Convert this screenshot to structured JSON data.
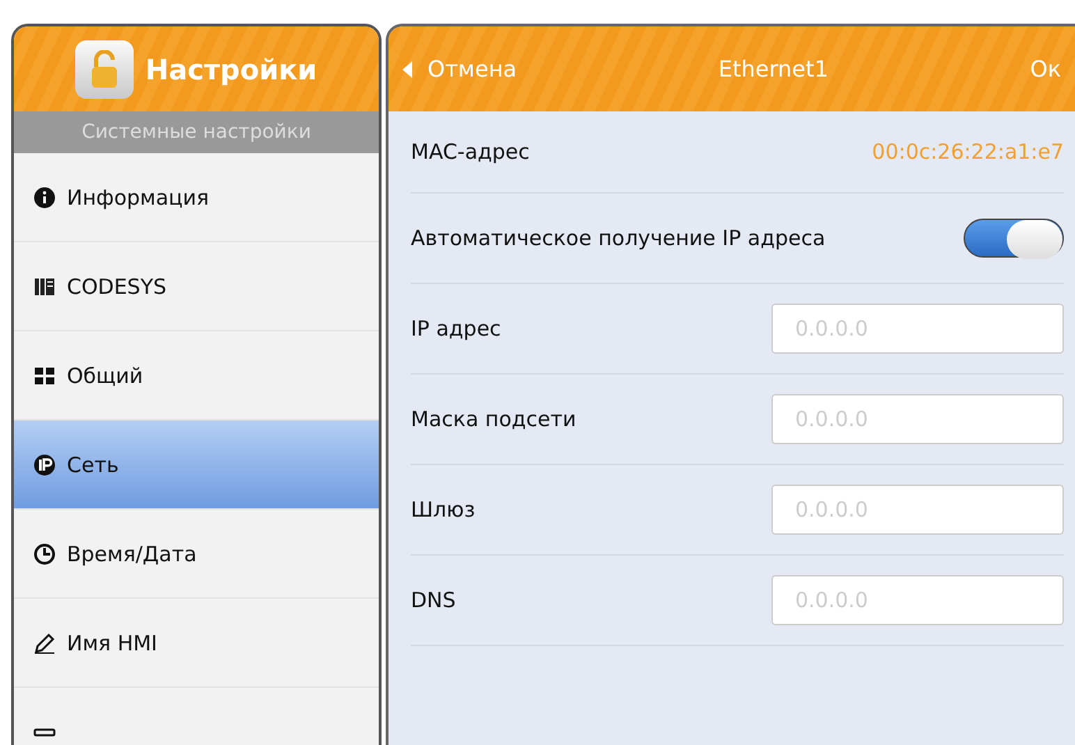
{
  "sidebar": {
    "title": "Настройки",
    "subtitle": "Системные настройки",
    "items": [
      {
        "label": "Информация",
        "selected": false
      },
      {
        "label": "CODESYS",
        "selected": false
      },
      {
        "label": "Общий",
        "selected": false
      },
      {
        "label": "Сеть",
        "selected": true
      },
      {
        "label": "Время/Дата",
        "selected": false
      },
      {
        "label": "Имя HMI",
        "selected": false
      },
      {
        "selected": false
      }
    ]
  },
  "panel": {
    "back_label": "Отмена",
    "title": "Ethernet1",
    "ok_label": "Ок",
    "rows": [
      {
        "kind": "value",
        "label": "MAC-адрес",
        "value": "00:0c:26:22:a1:e7"
      },
      {
        "kind": "toggle",
        "label": "Автоматическое получение IP адреса",
        "on": true
      },
      {
        "kind": "field",
        "label": "IP адрес",
        "placeholder": "0.0.0.0"
      },
      {
        "kind": "field",
        "label": "Маска подсети",
        "placeholder": "0.0.0.0"
      },
      {
        "kind": "field",
        "label": "Шлюз",
        "placeholder": "0.0.0.0"
      },
      {
        "kind": "field",
        "label": "DNS",
        "placeholder": "0.0.0.0"
      }
    ]
  }
}
